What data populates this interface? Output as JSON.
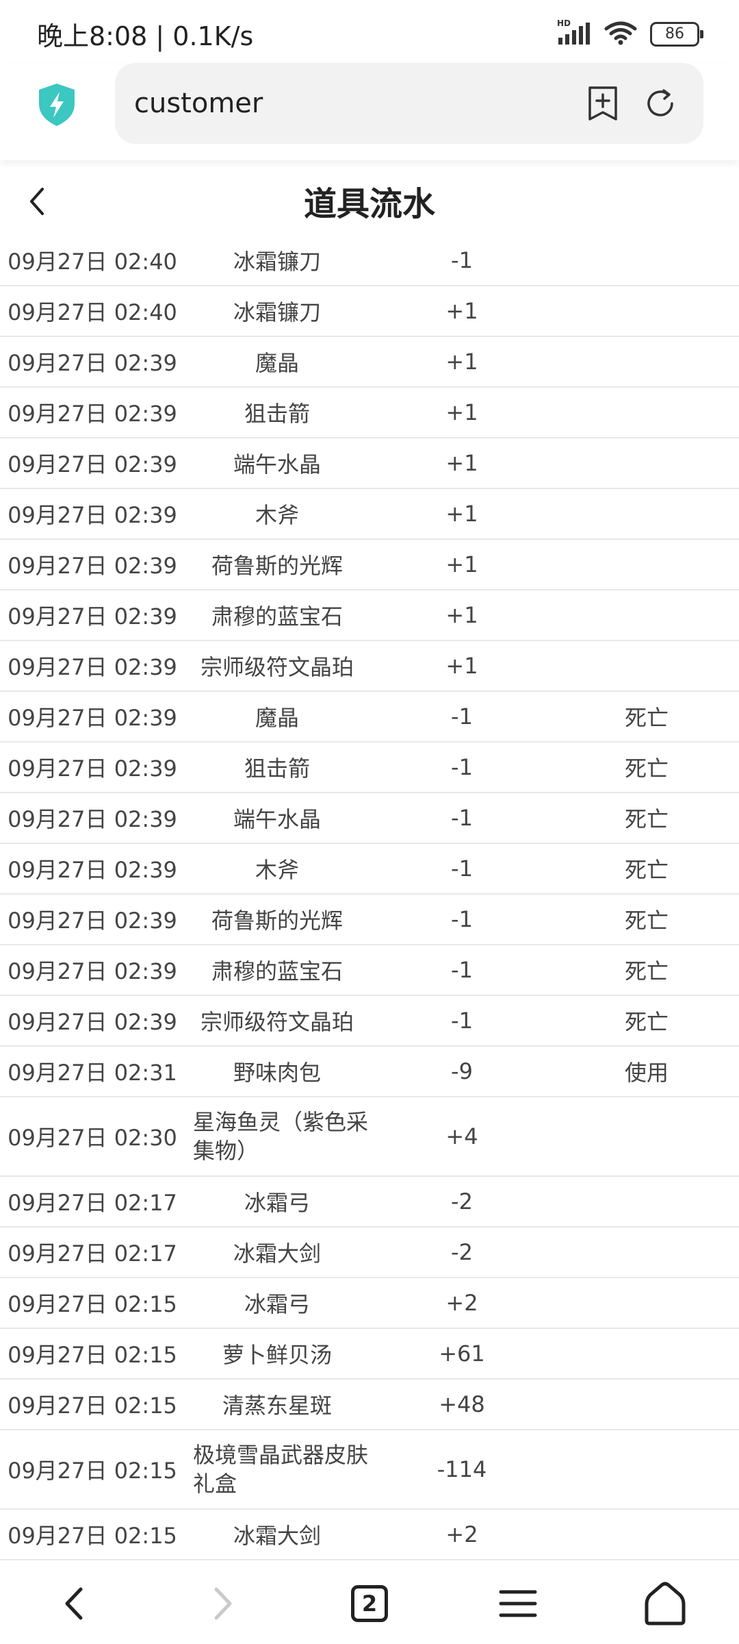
{
  "status_bar": {
    "time_speed": "晚上8:08 | 0.1K/s",
    "network": "HD",
    "battery": "86"
  },
  "address_bar": {
    "url": "customer"
  },
  "page": {
    "title": "道具流水"
  },
  "rows": [
    {
      "time": "09月27日 02:40",
      "item": "冰霜镰刀",
      "qty": "-1",
      "reason": ""
    },
    {
      "time": "09月27日 02:40",
      "item": "冰霜镰刀",
      "qty": "+1",
      "reason": ""
    },
    {
      "time": "09月27日 02:39",
      "item": "魔晶",
      "qty": "+1",
      "reason": ""
    },
    {
      "time": "09月27日 02:39",
      "item": "狙击箭",
      "qty": "+1",
      "reason": ""
    },
    {
      "time": "09月27日 02:39",
      "item": "端午水晶",
      "qty": "+1",
      "reason": ""
    },
    {
      "time": "09月27日 02:39",
      "item": "木斧",
      "qty": "+1",
      "reason": ""
    },
    {
      "time": "09月27日 02:39",
      "item": "荷鲁斯的光辉",
      "qty": "+1",
      "reason": ""
    },
    {
      "time": "09月27日 02:39",
      "item": "肃穆的蓝宝石",
      "qty": "+1",
      "reason": ""
    },
    {
      "time": "09月27日 02:39",
      "item": "宗师级符文晶珀",
      "qty": "+1",
      "reason": ""
    },
    {
      "time": "09月27日 02:39",
      "item": "魔晶",
      "qty": "-1",
      "reason": "死亡"
    },
    {
      "time": "09月27日 02:39",
      "item": "狙击箭",
      "qty": "-1",
      "reason": "死亡"
    },
    {
      "time": "09月27日 02:39",
      "item": "端午水晶",
      "qty": "-1",
      "reason": "死亡"
    },
    {
      "time": "09月27日 02:39",
      "item": "木斧",
      "qty": "-1",
      "reason": "死亡"
    },
    {
      "time": "09月27日 02:39",
      "item": "荷鲁斯的光辉",
      "qty": "-1",
      "reason": "死亡"
    },
    {
      "time": "09月27日 02:39",
      "item": "肃穆的蓝宝石",
      "qty": "-1",
      "reason": "死亡"
    },
    {
      "time": "09月27日 02:39",
      "item": "宗师级符文晶珀",
      "qty": "-1",
      "reason": "死亡"
    },
    {
      "time": "09月27日 02:31",
      "item": "野味肉包",
      "qty": "-9",
      "reason": "使用"
    },
    {
      "time": "09月27日 02:30",
      "item": "星海鱼灵（紫色采集物）",
      "qty": "+4",
      "reason": ""
    },
    {
      "time": "09月27日 02:17",
      "item": "冰霜弓",
      "qty": "-2",
      "reason": ""
    },
    {
      "time": "09月27日 02:17",
      "item": "冰霜大剑",
      "qty": "-2",
      "reason": ""
    },
    {
      "time": "09月27日 02:15",
      "item": "冰霜弓",
      "qty": "+2",
      "reason": ""
    },
    {
      "time": "09月27日 02:15",
      "item": "萝卜鲜贝汤",
      "qty": "+61",
      "reason": ""
    },
    {
      "time": "09月27日 02:15",
      "item": "清蒸东星斑",
      "qty": "+48",
      "reason": ""
    },
    {
      "time": "09月27日 02:15",
      "item": "极境雪晶武器皮肤礼盒",
      "qty": "-114",
      "reason": ""
    },
    {
      "time": "09月27日 02:15",
      "item": "冰霜大剑",
      "qty": "+2",
      "reason": ""
    }
  ],
  "bottom_nav": {
    "tab_count": "2"
  },
  "colors": {
    "accent": "#3cc7c0",
    "text": "#444444",
    "divider": "#e8e8e8"
  }
}
